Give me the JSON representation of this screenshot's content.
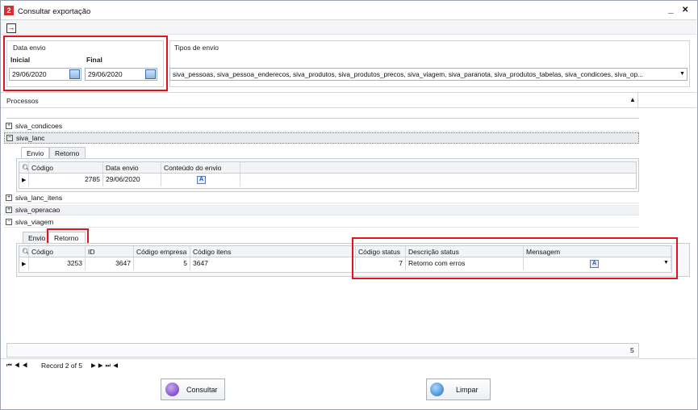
{
  "window": {
    "title": "Consultar exportação",
    "minimize": "_",
    "close": "✕"
  },
  "data_envio": {
    "group_label": "Data envio",
    "inicial_label": "Inicial",
    "inicial_value": "29/06/2020",
    "final_label": "Final",
    "final_value": "29/06/2020"
  },
  "tipos_envio": {
    "group_label": "Tipos de envio",
    "value": "siva_pessoas, siva_pessoa_enderecos, siva_produtos, siva_produtos_precos, siva_viagem, siva_paranota, siva_produtos_tabelas, siva_condicoes, siva_op..."
  },
  "processos": {
    "label": "Processos"
  },
  "tree": {
    "siva_condicoes": "siva_condicoes",
    "siva_lanc": "siva_lanc",
    "siva_lanc_itens": "siva_lanc_itens",
    "siva_operacao": "siva_operacao",
    "siva_viagem": "siva_viagem"
  },
  "tabs": {
    "envio": "Envio",
    "retorno": "Retorno"
  },
  "lanc_grid": {
    "columns": [
      "Código",
      "Data envio",
      "Conteúdo do envio"
    ],
    "row": {
      "codigo": "2785",
      "data_envio": "29/06/2020"
    }
  },
  "viagem_grid": {
    "columns": [
      "Código",
      "ID",
      "Código empresa",
      "Código itens",
      "Código status",
      "Descrição status",
      "Mensagem"
    ],
    "row": {
      "codigo": "3253",
      "id": "3647",
      "codigo_empresa": "5",
      "codigo_itens": "3647",
      "codigo_status": "7",
      "descricao_status": "Retorno com erros"
    }
  },
  "footer": {
    "count": "5"
  },
  "nav": {
    "record": "Record 2 of 5"
  },
  "buttons": {
    "consultar": "Consultar",
    "limpar": "Limpar"
  }
}
